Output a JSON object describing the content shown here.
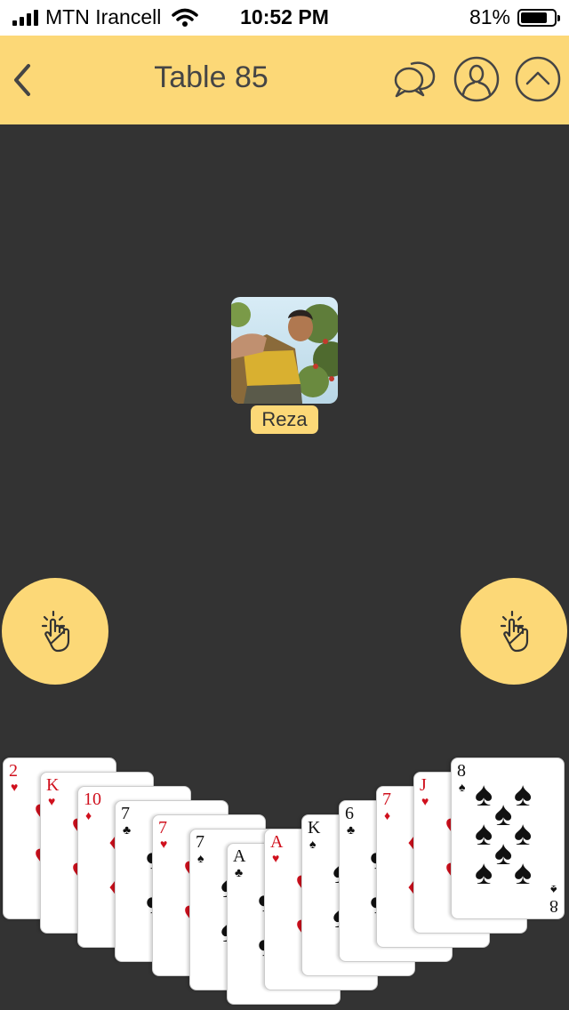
{
  "status_bar": {
    "carrier": "MTN Irancell",
    "time": "10:52 PM",
    "battery": "81%",
    "battery_level": 0.81
  },
  "header": {
    "title": "Table 85",
    "icons": [
      "back-icon",
      "chat-icon",
      "profile-icon",
      "collapse-up-icon"
    ]
  },
  "player": {
    "name": "Reza"
  },
  "tap_buttons": {
    "icon": "tap-hand-icon",
    "count": 2
  },
  "hand": {
    "cards": [
      {
        "rank": "2",
        "suit": "♥",
        "color": "red"
      },
      {
        "rank": "K",
        "suit": "♥",
        "color": "red"
      },
      {
        "rank": "10",
        "suit": "♦",
        "color": "red"
      },
      {
        "rank": "7",
        "suit": "♣",
        "color": "black"
      },
      {
        "rank": "7",
        "suit": "♥",
        "color": "red"
      },
      {
        "rank": "7",
        "suit": "♠",
        "color": "black"
      },
      {
        "rank": "A",
        "suit": "♣",
        "color": "black"
      },
      {
        "rank": "A",
        "suit": "♥",
        "color": "red"
      },
      {
        "rank": "K",
        "suit": "♠",
        "color": "black"
      },
      {
        "rank": "6",
        "suit": "♣",
        "color": "black"
      },
      {
        "rank": "7",
        "suit": "♦",
        "color": "red"
      },
      {
        "rank": "J",
        "suit": "♥",
        "color": "red"
      },
      {
        "rank": "8",
        "suit": "♠",
        "color": "black"
      }
    ]
  },
  "colors": {
    "accent": "#fcd877",
    "table": "#333333",
    "red_suit": "#d0101d",
    "black_suit": "#111111"
  }
}
